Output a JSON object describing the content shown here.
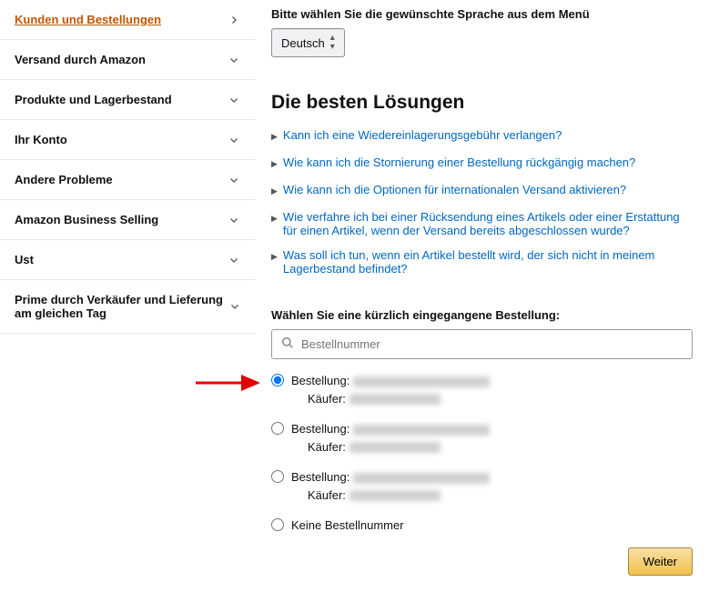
{
  "sidebar": {
    "items": [
      {
        "label": "Kunden und Bestellungen",
        "active": true,
        "dir": "right"
      },
      {
        "label": "Versand durch Amazon",
        "active": false,
        "dir": "down"
      },
      {
        "label": "Produkte und Lagerbestand",
        "active": false,
        "dir": "down"
      },
      {
        "label": "Ihr Konto",
        "active": false,
        "dir": "down"
      },
      {
        "label": "Andere Probleme",
        "active": false,
        "dir": "down"
      },
      {
        "label": "Amazon Business Selling",
        "active": false,
        "dir": "down"
      },
      {
        "label": "Ust",
        "active": false,
        "dir": "down"
      },
      {
        "label": "Prime durch Verkäufer und Lieferung am gleichen Tag",
        "active": false,
        "dir": "down"
      }
    ]
  },
  "language": {
    "prompt": "Bitte wählen Sie die gewünschte Sprache aus dem Menü",
    "selected": "Deutsch"
  },
  "solutions": {
    "title": "Die besten Lösungen",
    "items": [
      "Kann ich eine Wiedereinlagerungsgebühr verlangen?",
      "Wie kann ich die Stornierung einer Bestellung rückgängig machen?",
      "Wie kann ich die Optionen für internationalen Versand aktivieren?",
      "Wie verfahre ich bei einer Rücksendung eines Artikels oder einer Erstattung für einen Artikel, wenn der Versand bereits abgeschlossen wurde?",
      "Was soll ich tun, wenn ein Artikel bestellt wird, der sich nicht in meinem Lagerbestand befindet?"
    ]
  },
  "order_select": {
    "prompt": "Wählen Sie eine kürzlich eingegangene Bestellung:",
    "search_placeholder": "Bestellnummer",
    "row_label_order": "Bestellung:",
    "row_label_buyer": "Käufer:",
    "no_order_label": "Keine Bestellnummer"
  },
  "buttons": {
    "continue": "Weiter"
  }
}
